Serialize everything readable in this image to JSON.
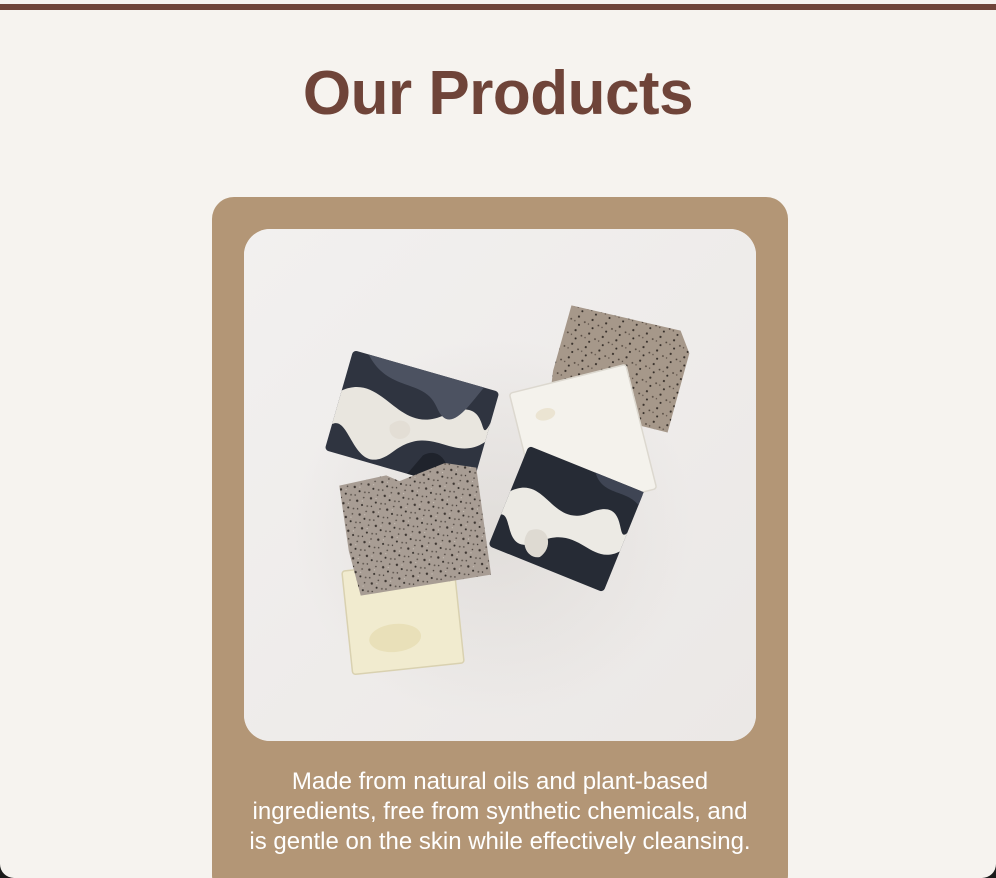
{
  "page": {
    "title": "Our Products"
  },
  "product_card": {
    "image_subject": "handmade soap bars",
    "description": "Made from natural oils and plant-based ingredients, free from synthetic chemicals, and is gentle on the skin while effectively cleansing."
  },
  "colors": {
    "accent": "#6f4439",
    "card": "#b39676",
    "background": "#f6f3ef"
  }
}
